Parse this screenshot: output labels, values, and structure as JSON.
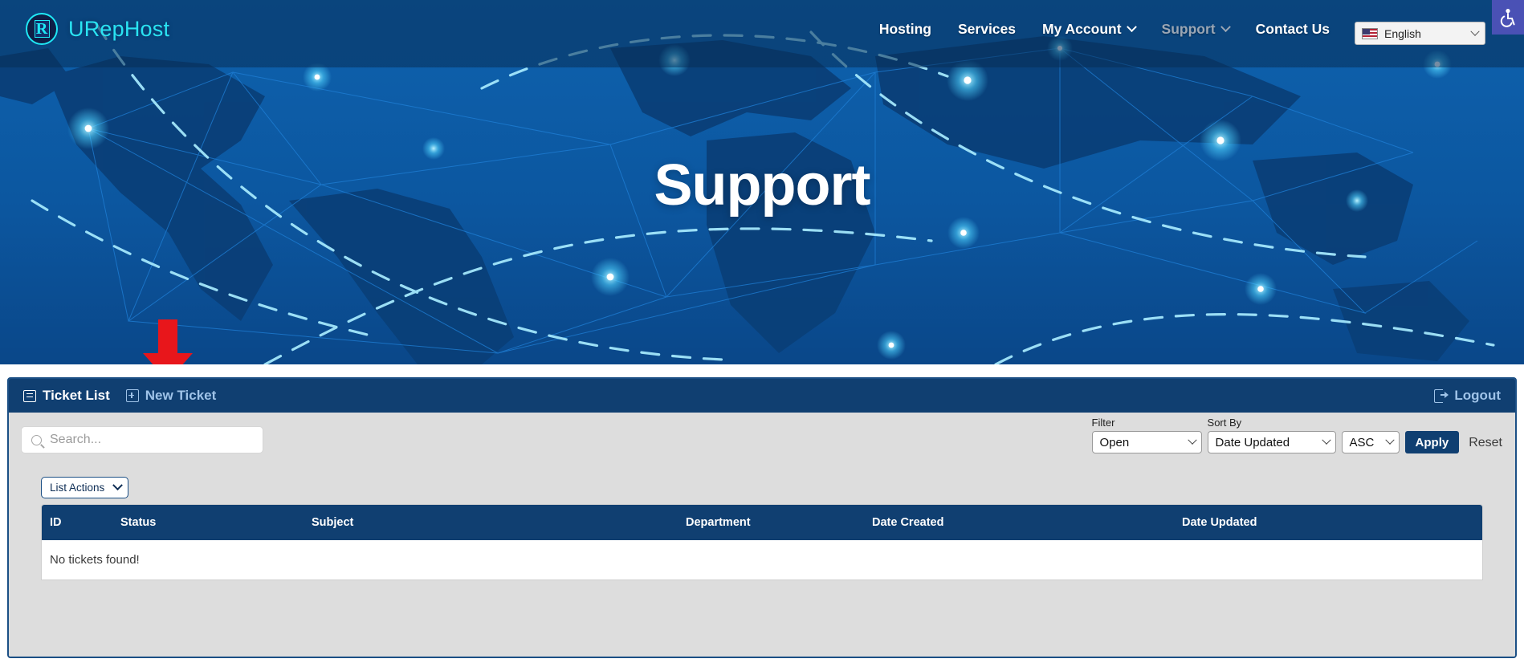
{
  "header": {
    "brand": "URepHost",
    "brand_icon": "urephost-logo-icon",
    "nav": [
      {
        "label": "Hosting",
        "has_caret": false,
        "muted": false
      },
      {
        "label": "Services",
        "has_caret": false,
        "muted": false
      },
      {
        "label": "My Account",
        "has_caret": true,
        "muted": false
      },
      {
        "label": "Support",
        "has_caret": true,
        "muted": true
      },
      {
        "label": "Contact Us",
        "has_caret": false,
        "muted": false
      }
    ],
    "language": {
      "label": "English",
      "flag_icon": "us-flag-icon",
      "caret_icon": "chevron-down-icon"
    },
    "accessibility_icon": "wheelchair-accessibility-icon",
    "accent_color": "#2ae3f2",
    "accessibility_color": "#4a51b5"
  },
  "hero": {
    "title": "Support",
    "background_description": "world-map-network-graphic",
    "bg_color": "#0d5ba3"
  },
  "annotation": {
    "arrow_icon": "red-down-arrow-icon",
    "color": "#e8161b"
  },
  "panel": {
    "toolbar": {
      "ticket_list_label": "Ticket List",
      "ticket_list_icon": "list-box-icon",
      "new_ticket_label": "New Ticket",
      "new_ticket_icon": "plus-box-icon",
      "logout_label": "Logout",
      "logout_icon": "logout-icon",
      "bg_color": "#103f71"
    },
    "search": {
      "placeholder": "Search...",
      "value": "",
      "icon": "search-icon"
    },
    "filters": {
      "filter_label": "Filter",
      "filter_value": "Open",
      "sort_label": "Sort By",
      "sort_value": "Date Updated",
      "direction_value": "ASC",
      "apply_label": "Apply",
      "reset_label": "Reset",
      "caret_icon": "chevron-down-icon"
    },
    "list_actions": {
      "label": "List Actions",
      "caret_icon": "chevron-down-icon"
    },
    "table": {
      "columns": [
        "ID",
        "Status",
        "Subject",
        "Department",
        "Date Created",
        "Date Updated"
      ],
      "rows": [],
      "empty_message": "No tickets found!"
    }
  }
}
